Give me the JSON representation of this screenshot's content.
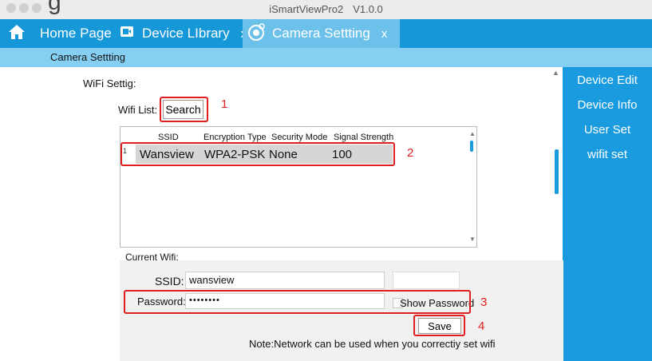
{
  "window": {
    "title": "iSmartViewPro2",
    "version": "V1.0.0",
    "partial_heading": "g"
  },
  "tabs": [
    {
      "label": "Home Page"
    },
    {
      "label": "Device LIbrary",
      "close": "x"
    },
    {
      "label": "Camera Settting",
      "close": "x"
    }
  ],
  "header": {
    "title": "Camera Settting"
  },
  "side_menu": [
    {
      "label": "Device Edit"
    },
    {
      "label": "Device Info"
    },
    {
      "label": "User Set"
    },
    {
      "label": "wifit set"
    }
  ],
  "wifi": {
    "section_label": "WiFi Settig:",
    "list_label": "Wifi List:",
    "search_label": "Search",
    "columns": [
      "SSID",
      "Encryption Type",
      "Security Mode",
      "Signal Strength"
    ],
    "rows": [
      {
        "index": "1",
        "ssid": "Wansview",
        "encryption": "WPA2-PSK",
        "security": "None",
        "signal": "100"
      }
    ]
  },
  "current_wifi": {
    "label": "Current Wifi:",
    "ssid_label": "SSID:",
    "ssid_value": "wansview",
    "password_label": "Password:",
    "password_value": "••••••••",
    "show_password_label": "Show Password",
    "save_label": "Save",
    "note": "Note:Network can be used when you correctiy set wifi"
  },
  "annotations": [
    "1",
    "2",
    "3",
    "4"
  ],
  "colors": {
    "accent": "#1597d8",
    "header": "#84cff2",
    "side_panel": "#1a9bdf",
    "highlight": "#e02020"
  }
}
